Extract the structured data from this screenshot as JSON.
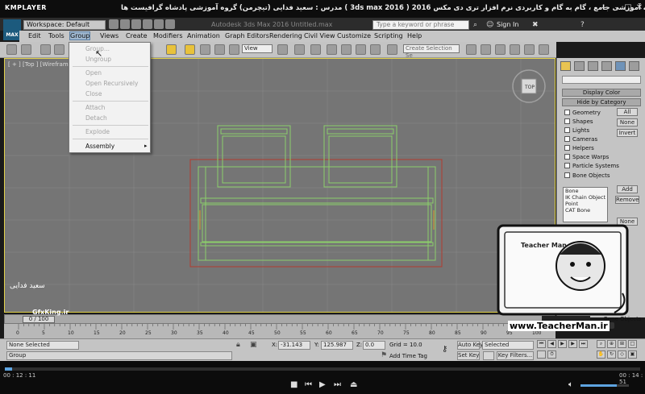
{
  "player": {
    "logo": "KMPLAYER",
    "title": "مجموعه آموزشی جامع ، گام به گام و کاربردی نرم افزار تری دی مکس 2016 ( 3ds max 2016 )   مدرس : سعید فدایی (تیچرمن) گروه آموزشی پادشاه گرافیست ها",
    "time_current": "00 : 12 : 11",
    "time_total": "00 : 14 : 51"
  },
  "max": {
    "logo": "MAX",
    "workspace": "Workspace: Default",
    "doc_title": "Autodesk 3ds Max 2016   Untitled.max",
    "search_placeholder": "Type a keyword or phrase",
    "signin": "Sign In"
  },
  "menubar": [
    "Edit",
    "Tools",
    "Group",
    "Views",
    "Create",
    "Modifiers",
    "Animation",
    "Graph Editors",
    "Rendering",
    "Civil View",
    "Customize",
    "Scripting",
    "Help"
  ],
  "toolbar": {
    "view_combo": "View",
    "selection_set": "Create Selection Se"
  },
  "group_menu": {
    "items": [
      {
        "label": "Group...",
        "enabled": false
      },
      {
        "label": "Ungroup",
        "enabled": false
      },
      {
        "label": "Open",
        "enabled": false
      },
      {
        "label": "Open Recursively",
        "enabled": false
      },
      {
        "label": "Close",
        "enabled": false
      },
      {
        "label": "Attach",
        "enabled": false
      },
      {
        "label": "Detach",
        "enabled": false
      },
      {
        "label": "Explode",
        "enabled": false
      },
      {
        "label": "Assembly",
        "enabled": true,
        "submenu": true
      }
    ]
  },
  "viewport": {
    "label": "[ + ] [Top ] [Wireframe ]",
    "border_color": "#e3d34a",
    "bg_color": "#757575"
  },
  "command_panel": {
    "display_color": "Display Color",
    "hide_by_category": "Hide by Category",
    "categories": [
      "Geometry",
      "Shapes",
      "Lights",
      "Cameras",
      "Helpers",
      "Space Warps",
      "Particle Systems",
      "Bone Objects"
    ],
    "buttons": [
      "All",
      "None",
      "Invert"
    ],
    "list": [
      "Bone",
      "IK Chain Object",
      "Point",
      "CAT Bone"
    ],
    "add": "Add",
    "remove": "Remove",
    "none2": "None",
    "objects_label": "Bone Objects"
  },
  "timeline": {
    "frame_display": "0 / 100",
    "ticks": [
      "0",
      "5",
      "10",
      "15",
      "20",
      "25",
      "30",
      "35",
      "40",
      "45",
      "50",
      "55",
      "60",
      "65",
      "70",
      "75",
      "80",
      "85",
      "90",
      "95",
      "100"
    ]
  },
  "status": {
    "none_selected": "None Selected",
    "group_prompt": "Group",
    "x_label": "X:",
    "x_value": "-31.143",
    "y_label": "Y:",
    "y_value": "125.987",
    "z_label": "Z:",
    "z_value": "0.0",
    "grid": "Grid = 10.0",
    "add_time_tag": "Add Time Tag",
    "auto_key": "Auto Key",
    "set_key": "Set Key",
    "selected": "Selected",
    "key_filters": "Key Filters..."
  },
  "watermark": {
    "url": "www.TeacherMan.ir",
    "name": "Teacher Man",
    "sig": "سعید فدایی",
    "site": "GfxKing.ir"
  }
}
